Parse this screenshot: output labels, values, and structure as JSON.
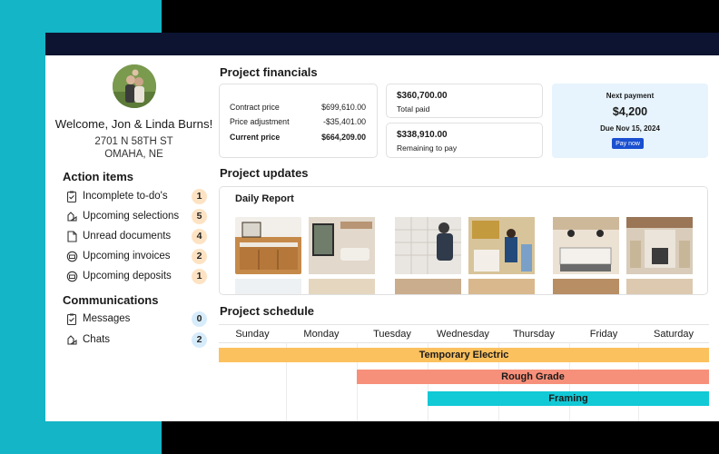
{
  "user": {
    "welcome": "Welcome, Jon & Linda Burns!",
    "address_line1": "2701 N 58TH ST",
    "address_line2": "OMAHA, NE"
  },
  "action_items": {
    "title": "Action items",
    "items": [
      {
        "label": "Incomplete to-do's",
        "count": "1",
        "icon": "checklist-icon"
      },
      {
        "label": "Upcoming selections",
        "count": "5",
        "icon": "selection-icon"
      },
      {
        "label": "Unread documents",
        "count": "4",
        "icon": "document-icon"
      },
      {
        "label": "Upcoming invoices",
        "count": "2",
        "icon": "invoice-icon"
      },
      {
        "label": "Upcoming deposits",
        "count": "1",
        "icon": "deposit-icon"
      }
    ]
  },
  "communications": {
    "title": "Communications",
    "items": [
      {
        "label": "Messages",
        "count": "0",
        "icon": "message-icon"
      },
      {
        "label": "Chats",
        "count": "2",
        "icon": "chat-icon"
      }
    ]
  },
  "financials": {
    "title": "Project financials",
    "contract_label": "Contract price",
    "contract_value": "$699,610.00",
    "adjust_label": "Price adjustment",
    "adjust_value": "-$35,401.00",
    "current_label": "Current price",
    "current_value": "$664,209.00",
    "paid_amount": "$360,700.00",
    "paid_label": "Total paid",
    "remaining_amount": "$338,910.00",
    "remaining_label": "Remaining to pay",
    "next_label": "Next payment",
    "next_amount": "$4,200",
    "next_due": "Due Nov 15, 2024",
    "pay_button": "Pay now",
    "accent": "#1a4fd0"
  },
  "updates": {
    "title": "Project updates",
    "report_title": "Daily Report"
  },
  "schedule": {
    "title": "Project schedule",
    "days": [
      "Sunday",
      "Monday",
      "Tuesday",
      "Wednesday",
      "Thursday",
      "Friday",
      "Saturday"
    ],
    "tasks": [
      {
        "label": "Temporary Electric",
        "color": "#fbc15e"
      },
      {
        "label": "Rough Grade",
        "color": "#f7907a"
      },
      {
        "label": "Framing",
        "color": "#12c9d6"
      }
    ]
  }
}
